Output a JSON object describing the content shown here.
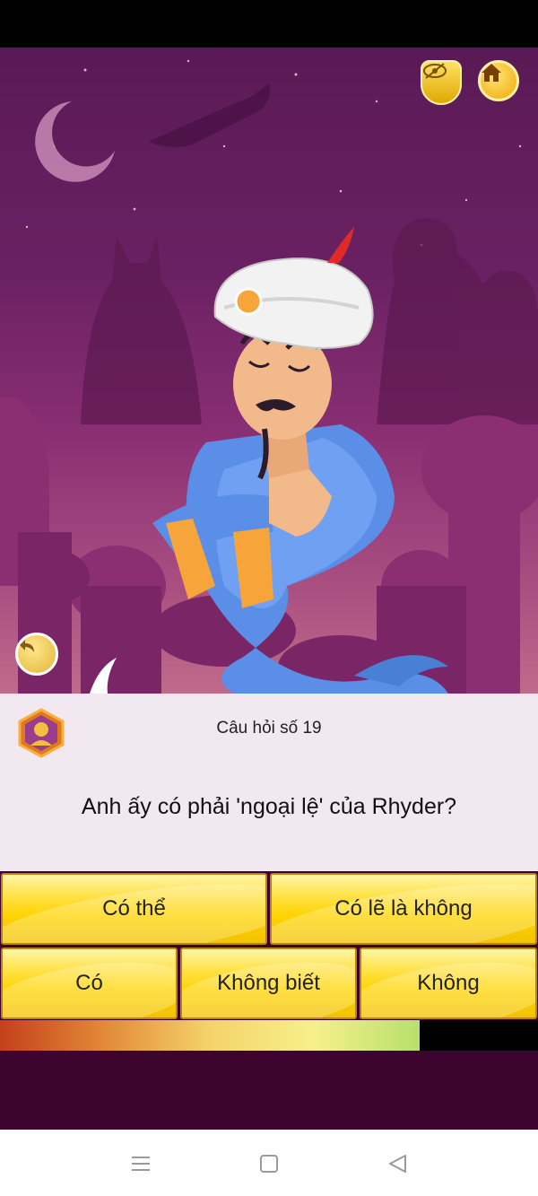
{
  "question": {
    "number_label": "Câu hỏi số 19",
    "text": "Anh ấy có phải 'ngoại lệ' của Rhyder?"
  },
  "answers": {
    "row1": [
      "Có thể",
      "Có lẽ là không"
    ],
    "row2": [
      "Có",
      "Không biết",
      "Không"
    ]
  },
  "progress": {
    "fraction": 0.78
  },
  "colors": {
    "scene_top": "#5a1a55",
    "panel_bg": "#f2e8f0",
    "answer_yellow": "#ffd400",
    "bottom_bg": "#3d0430"
  },
  "icons": {
    "hide": "eye-slash-icon",
    "home": "home-icon",
    "back": "undo-icon",
    "badge": "player-badge-icon"
  }
}
